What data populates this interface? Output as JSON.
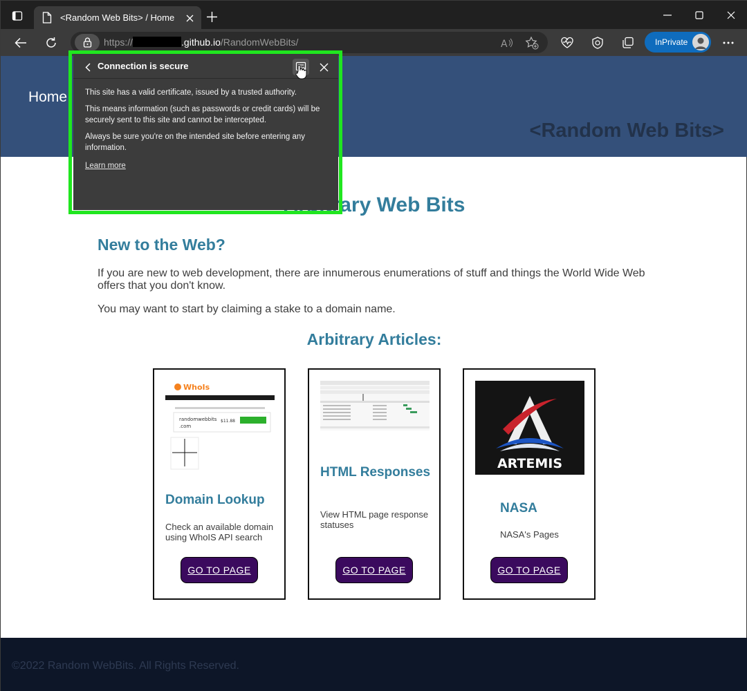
{
  "browser": {
    "tab_title": "<Random Web Bits> / Home",
    "url": {
      "scheme": "https://",
      "host_suffix": ".github.io",
      "path": "/RandomWebBits/"
    },
    "inprivate_label": "InPrivate"
  },
  "site": {
    "nav_home": "Home",
    "site_title": "<Random Web Bits>",
    "page_heading": "Arbitrary Web Bits",
    "intro_heading": "New to the Web?",
    "intro_p1": "If you are new to web development, there are innumerous enumerations of stuff and things the World Wide Web offers that you don't know.",
    "intro_p2": "You may want to start by claiming a stake to a domain name.",
    "articles_heading": "Arbitrary Articles:",
    "cards": [
      {
        "title": "Domain Lookup",
        "text": "Check an available domain using WhoIS API search",
        "button": "GO TO PAGE",
        "thumb_brand": "WhoIs",
        "thumb_domain": "randomwebbits.com",
        "thumb_price": "$11.88"
      },
      {
        "title": "HTML Responses",
        "text": "View HTML page response statuses",
        "button": "GO TO PAGE"
      },
      {
        "title": "NASA",
        "text": "NASA's Pages",
        "button": "GO TO PAGE",
        "thumb_logo_text": "ARTEMIS"
      }
    ],
    "footer": "©2022 Random WebBits. All Rights Reserved."
  },
  "security_popup": {
    "title": "Connection is secure",
    "line1": "This site has a valid certificate, issued by a trusted authority.",
    "line2": "This means information (such as passwords or credit cards) will be securely sent to this site and cannot be intercepted.",
    "line3": "Always be sure you're on the intended site before entering any information.",
    "learn_more": "Learn more",
    "highlight_color": "#20e61f"
  },
  "colors": {
    "header_bg": "#34507a",
    "heading": "#337d9c",
    "button_bg": "#3b0a5e",
    "footer_bg": "#0d1628",
    "inprivate": "#0f6cbd"
  }
}
